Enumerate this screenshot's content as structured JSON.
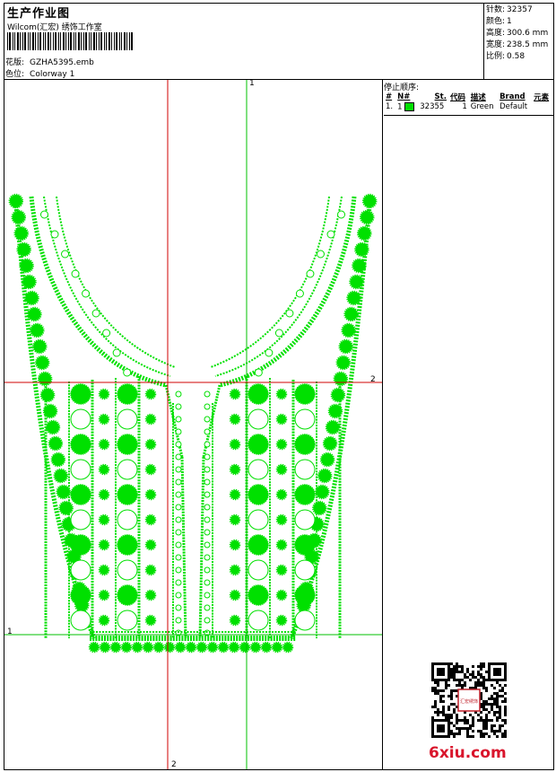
{
  "header": {
    "title": "生产作业图",
    "subtitle": "Wilcom(汇宏) 绣饰工作室",
    "pattern_label": "花版:",
    "pattern_value": "GZHA5395.emb",
    "colorway_label": "色位:",
    "colorway_value": "Colorway 1"
  },
  "meta": [
    {
      "label": "针数:",
      "value": "32357"
    },
    {
      "label": "颜色:",
      "value": "1"
    },
    {
      "label": "高度:",
      "value": "300.6 mm"
    },
    {
      "label": "宽度:",
      "value": "238.5 mm"
    },
    {
      "label": "比例:",
      "value": "0.58"
    }
  ],
  "stop_sequence": {
    "title": "停止顺序:",
    "columns": [
      "#",
      "N#",
      "St.",
      "代码",
      "描述",
      "Brand",
      "元素"
    ],
    "rows": [
      {
        "index": "1.",
        "n": "1",
        "stitches": "32355",
        "code": "1",
        "description": "Green",
        "brand": "Default",
        "color": "#00e000"
      }
    ]
  },
  "axes": {
    "v_left_label": "2",
    "v_right_label": "1",
    "h_top_label": "2",
    "h_bottom_label": "1"
  },
  "colors": {
    "thread": "#00e000",
    "axis_red": "#d00000",
    "axis_green": "#00c000"
  },
  "watermark": "6xiu.com",
  "qr_stamp_text": "汇宏绣饰"
}
